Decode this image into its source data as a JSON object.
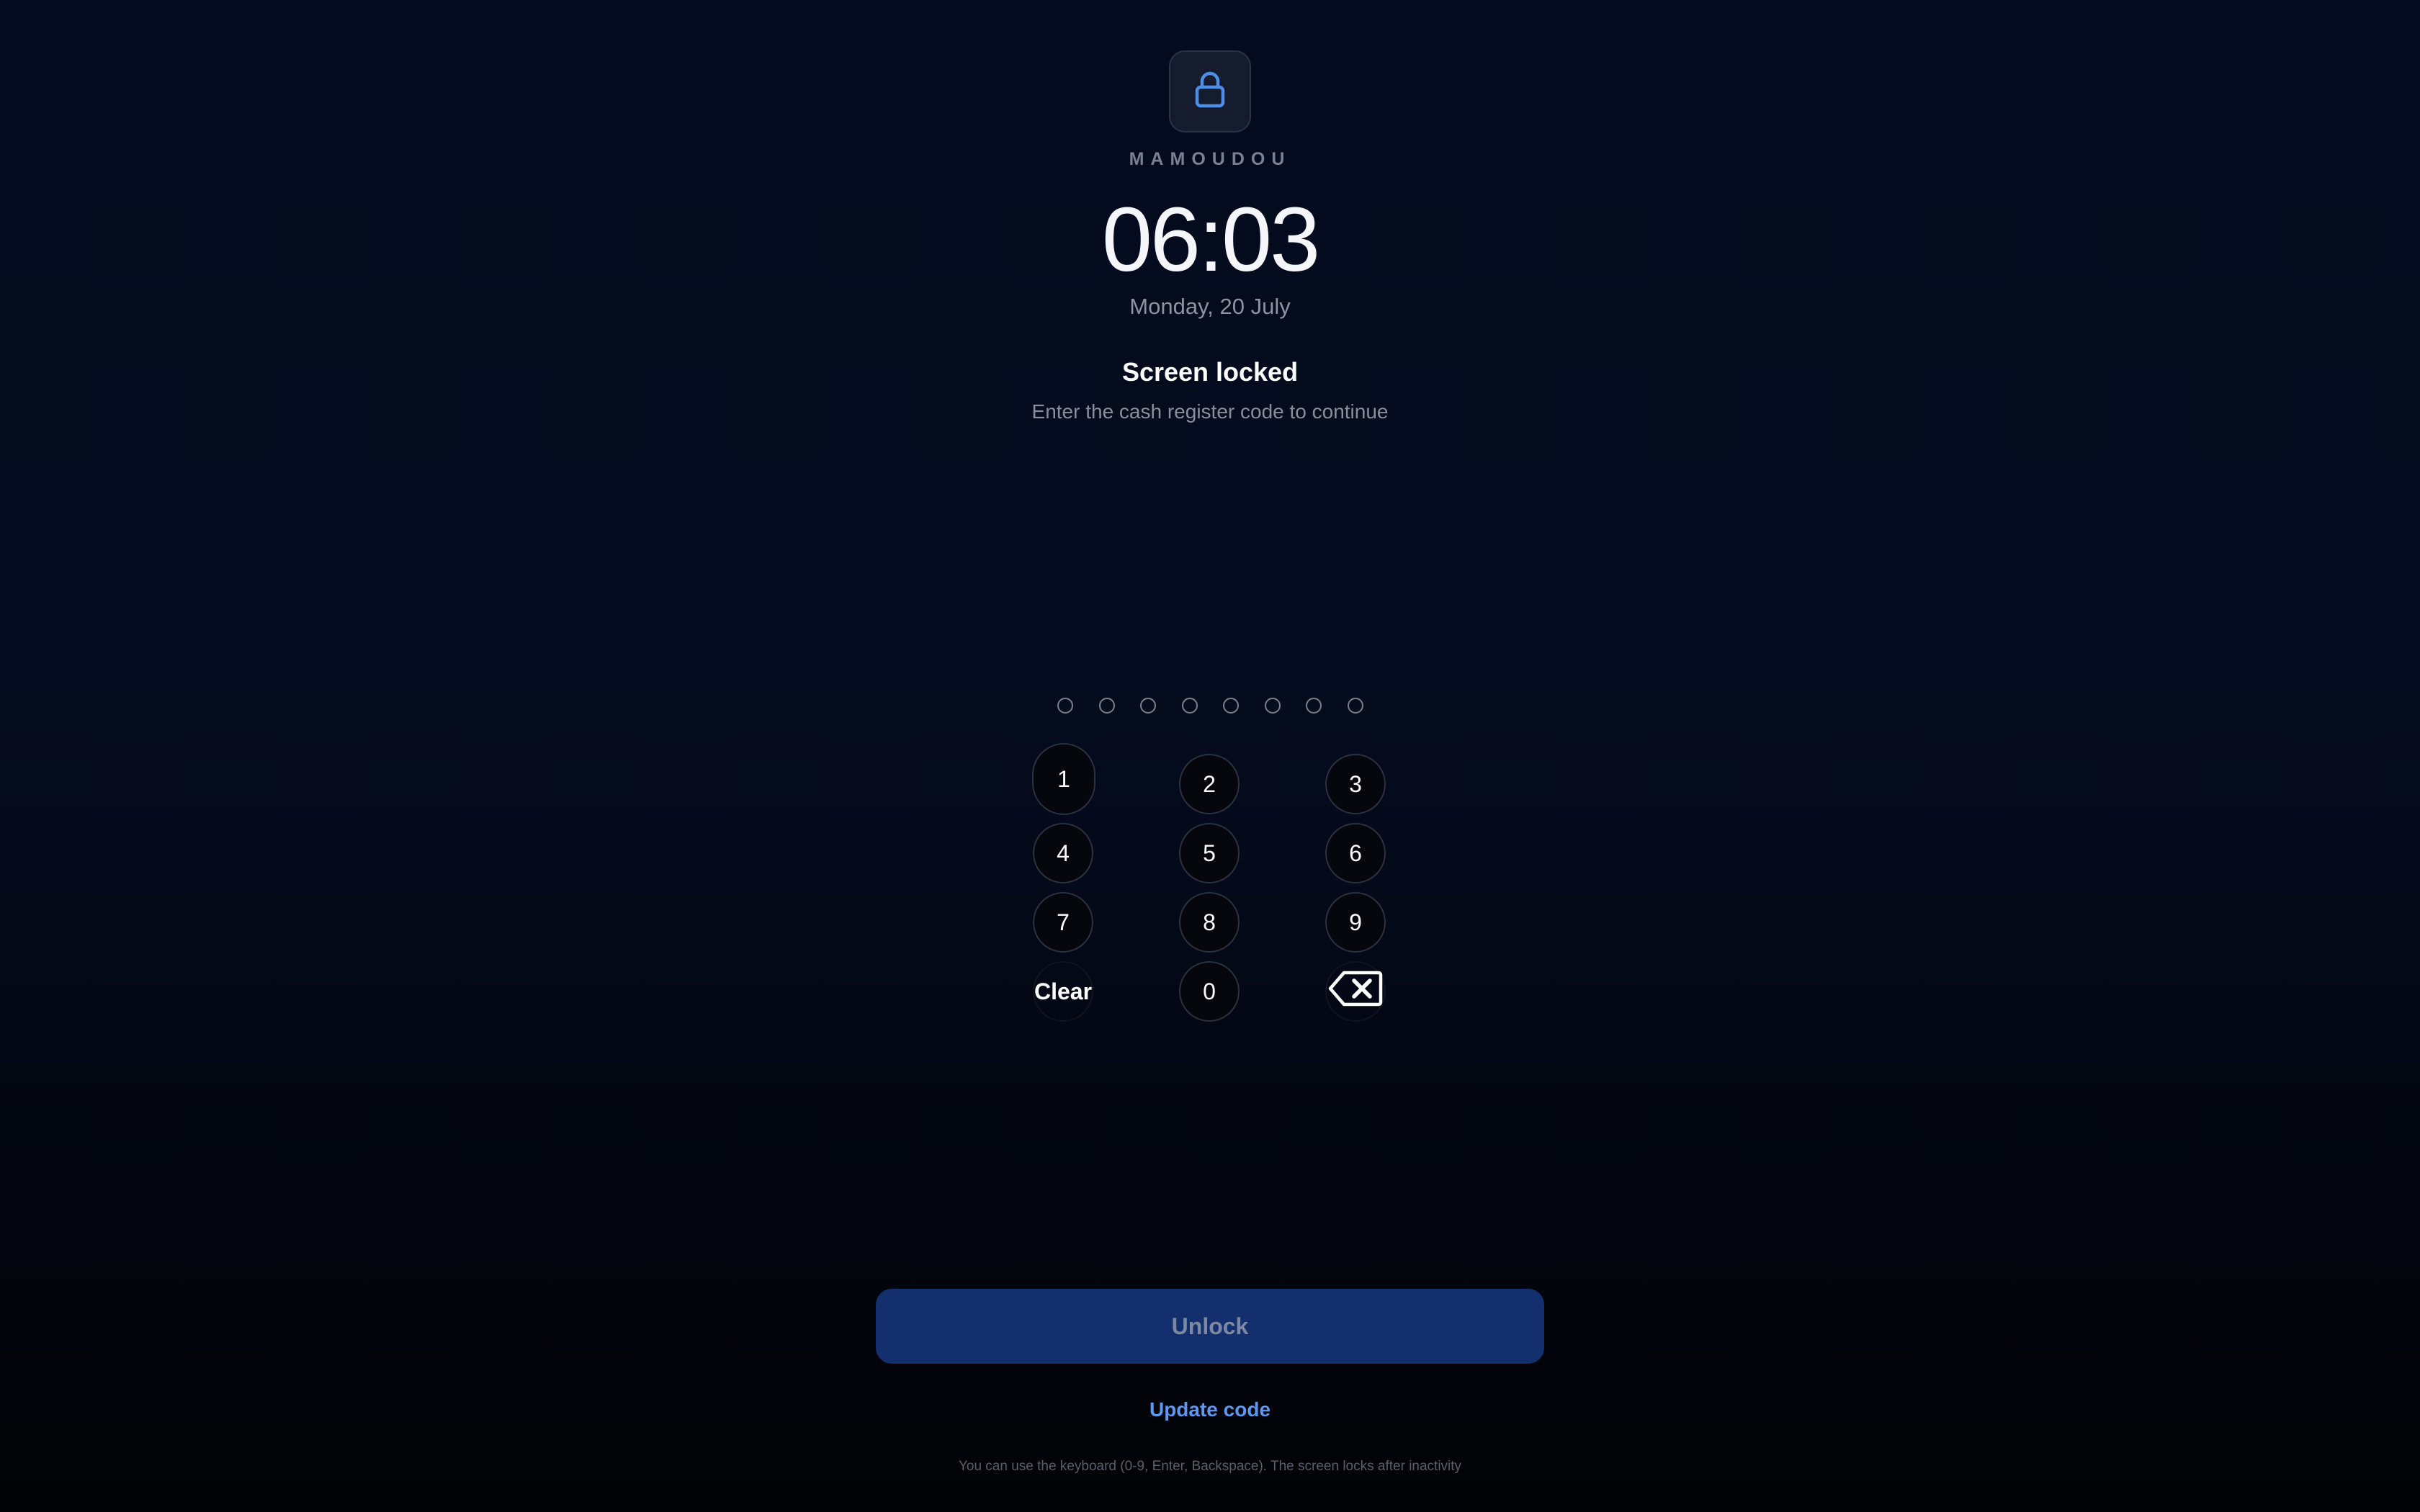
{
  "header": {
    "lock_icon": "lock-icon",
    "user_name": "MAMOUDOU",
    "time": "06:03",
    "date": "Monday, 20 July"
  },
  "lock_message": {
    "title": "Screen locked",
    "subtitle": "Enter the cash register code to continue"
  },
  "pin_indicator": {
    "length": 8,
    "filled": 0
  },
  "keypad": {
    "keys": [
      "1",
      "2",
      "3",
      "4",
      "5",
      "6",
      "7",
      "8",
      "9"
    ],
    "clear_label": "Clear",
    "zero_label": "0",
    "backspace_icon": "backspace-icon"
  },
  "actions": {
    "unlock_label": "Unlock",
    "update_code_label": "Update code"
  },
  "footer": {
    "hint": "You can use the keyboard (0-9, Enter, Backspace). The screen locks after inactivity"
  },
  "colors": {
    "background": "#050b1e",
    "accent": "#5e97f0",
    "unlock_button": "#142f6d"
  }
}
